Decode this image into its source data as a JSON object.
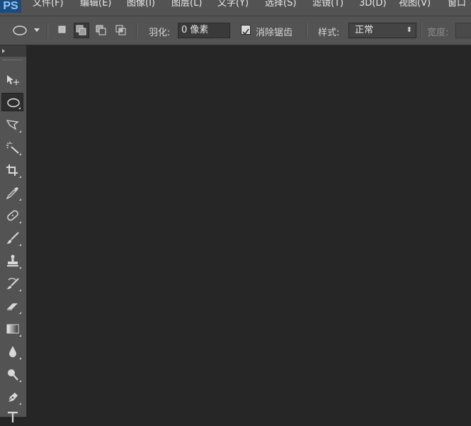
{
  "app": {
    "logo": "PS"
  },
  "menu": [
    "文件(F)",
    "编辑(E)",
    "图像(I)",
    "图层(L)",
    "文字(Y)",
    "选择(S)",
    "滤镜(T)",
    "3D(D)",
    "视图(V)",
    "窗口"
  ],
  "options": {
    "feather_label": "羽化:",
    "feather_value": "0 像素",
    "antialias_label": "消除锯齿",
    "antialias_checked": true,
    "style_label": "样式:",
    "style_value": "正常",
    "width_label": "宽度:"
  },
  "toolbar": {
    "tools": [
      {
        "name": "move-tool",
        "icon": "move-icon"
      },
      {
        "name": "elliptical-marquee-tool",
        "icon": "ellipse-marquee-icon",
        "active": true
      },
      {
        "name": "lasso-tool",
        "icon": "polygonal-lasso-icon"
      },
      {
        "name": "magic-wand-tool",
        "icon": "magic-wand-icon"
      },
      {
        "name": "crop-tool",
        "icon": "crop-icon"
      },
      {
        "name": "eyedropper-tool",
        "icon": "eyedropper-icon"
      },
      {
        "name": "healing-brush-tool",
        "icon": "bandage-icon"
      },
      {
        "name": "brush-tool",
        "icon": "brush-icon"
      },
      {
        "name": "clone-stamp-tool",
        "icon": "stamp-icon"
      },
      {
        "name": "history-brush-tool",
        "icon": "history-brush-icon"
      },
      {
        "name": "eraser-tool",
        "icon": "eraser-icon"
      },
      {
        "name": "gradient-tool",
        "icon": "gradient-icon"
      },
      {
        "name": "blur-tool",
        "icon": "drop-icon"
      },
      {
        "name": "dodge-tool",
        "icon": "dodge-icon"
      },
      {
        "name": "pen-tool",
        "icon": "pen-icon"
      },
      {
        "name": "type-tool",
        "icon": "type-icon"
      }
    ]
  },
  "colors": {
    "ui": "#535353",
    "canvas": "#262626",
    "logo_bg": "#1d4c7c",
    "logo_text": "#8fc8ff"
  }
}
